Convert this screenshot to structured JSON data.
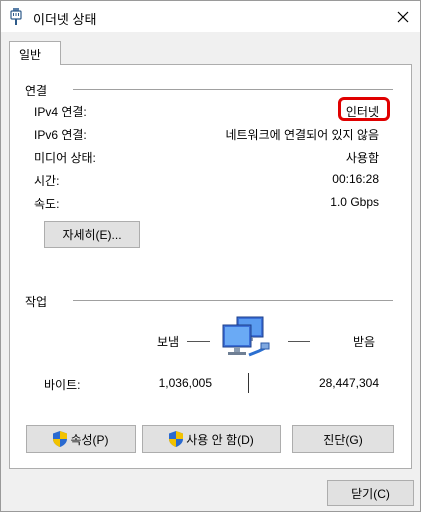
{
  "window": {
    "title": "이더넷 상태",
    "icon": "ethernet-icon",
    "close_glyph": "✕"
  },
  "tabs": [
    {
      "label": "일반",
      "active": true
    }
  ],
  "connection": {
    "heading": "연결",
    "rows": [
      {
        "label": "IPv4 연결:",
        "value": "인터넷"
      },
      {
        "label": "IPv6 연결:",
        "value": "네트워크에 연결되어 있지 않음"
      },
      {
        "label": "미디어 상태:",
        "value": "사용함"
      },
      {
        "label": "시간:",
        "value": "00:16:28"
      },
      {
        "label": "속도:",
        "value": "1.0 Gbps"
      }
    ],
    "details_button": "자세히(E)...",
    "highlight_color": "#e00000"
  },
  "activity": {
    "heading": "작업",
    "sent_label": "보냄",
    "received_label": "받음",
    "bytes_label": "바이트:",
    "sent_bytes": "1,036,005",
    "received_bytes": "28,447,304",
    "icon": "network-computers-icon"
  },
  "buttons": {
    "properties": "속성(P)",
    "disable": "사용 안 함(D)",
    "diagnose": "진단(G)",
    "close": "닫기(C)"
  },
  "colors": {
    "accent": "#0078d7"
  }
}
